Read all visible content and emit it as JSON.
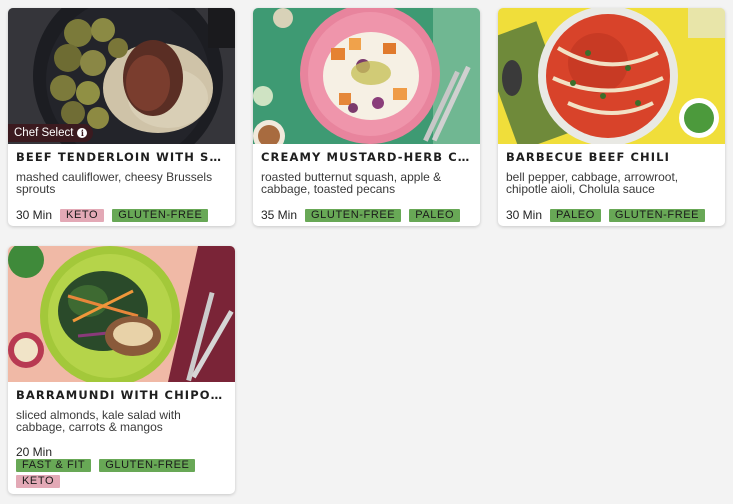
{
  "cards": [
    {
      "title": "BEEF TENDERLOIN WITH SHALLOT PAN SAUCE",
      "description": "mashed cauliflower, cheesy Brussels sprouts",
      "time": "30 Min",
      "badge": "Chef Select",
      "tags": [
        "KETO",
        "GLUTEN-FREE"
      ]
    },
    {
      "title": "CREAMY MUSTARD-HERB CHICKEN",
      "description": "roasted butternut squash, apple & cabbage, toasted pecans",
      "time": "35 Min",
      "tags": [
        "GLUTEN-FREE",
        "PALEO"
      ]
    },
    {
      "title": "BARBECUE BEEF CHILI",
      "description": "bell pepper, cabbage, arrowroot, chipotle aioli, Cholula sauce",
      "time": "30 Min",
      "tags": [
        "PALEO",
        "GLUTEN-FREE"
      ]
    },
    {
      "title": "BARRAMUNDI WITH CHIPOTLE LIME CREMA",
      "description": "sliced almonds, kale salad with cabbage, carrots & mangos",
      "time": "20 Min",
      "tags": [
        "FAST & FIT",
        "GLUTEN-FREE",
        "KETO"
      ]
    }
  ],
  "icons": {
    "info": "info-icon"
  },
  "colors": {
    "tag_keto": "#e3a9b6",
    "tag_green": "#68a856",
    "chef_badge": "#3b1a1f",
    "page_bg": "#f3f3f3"
  }
}
